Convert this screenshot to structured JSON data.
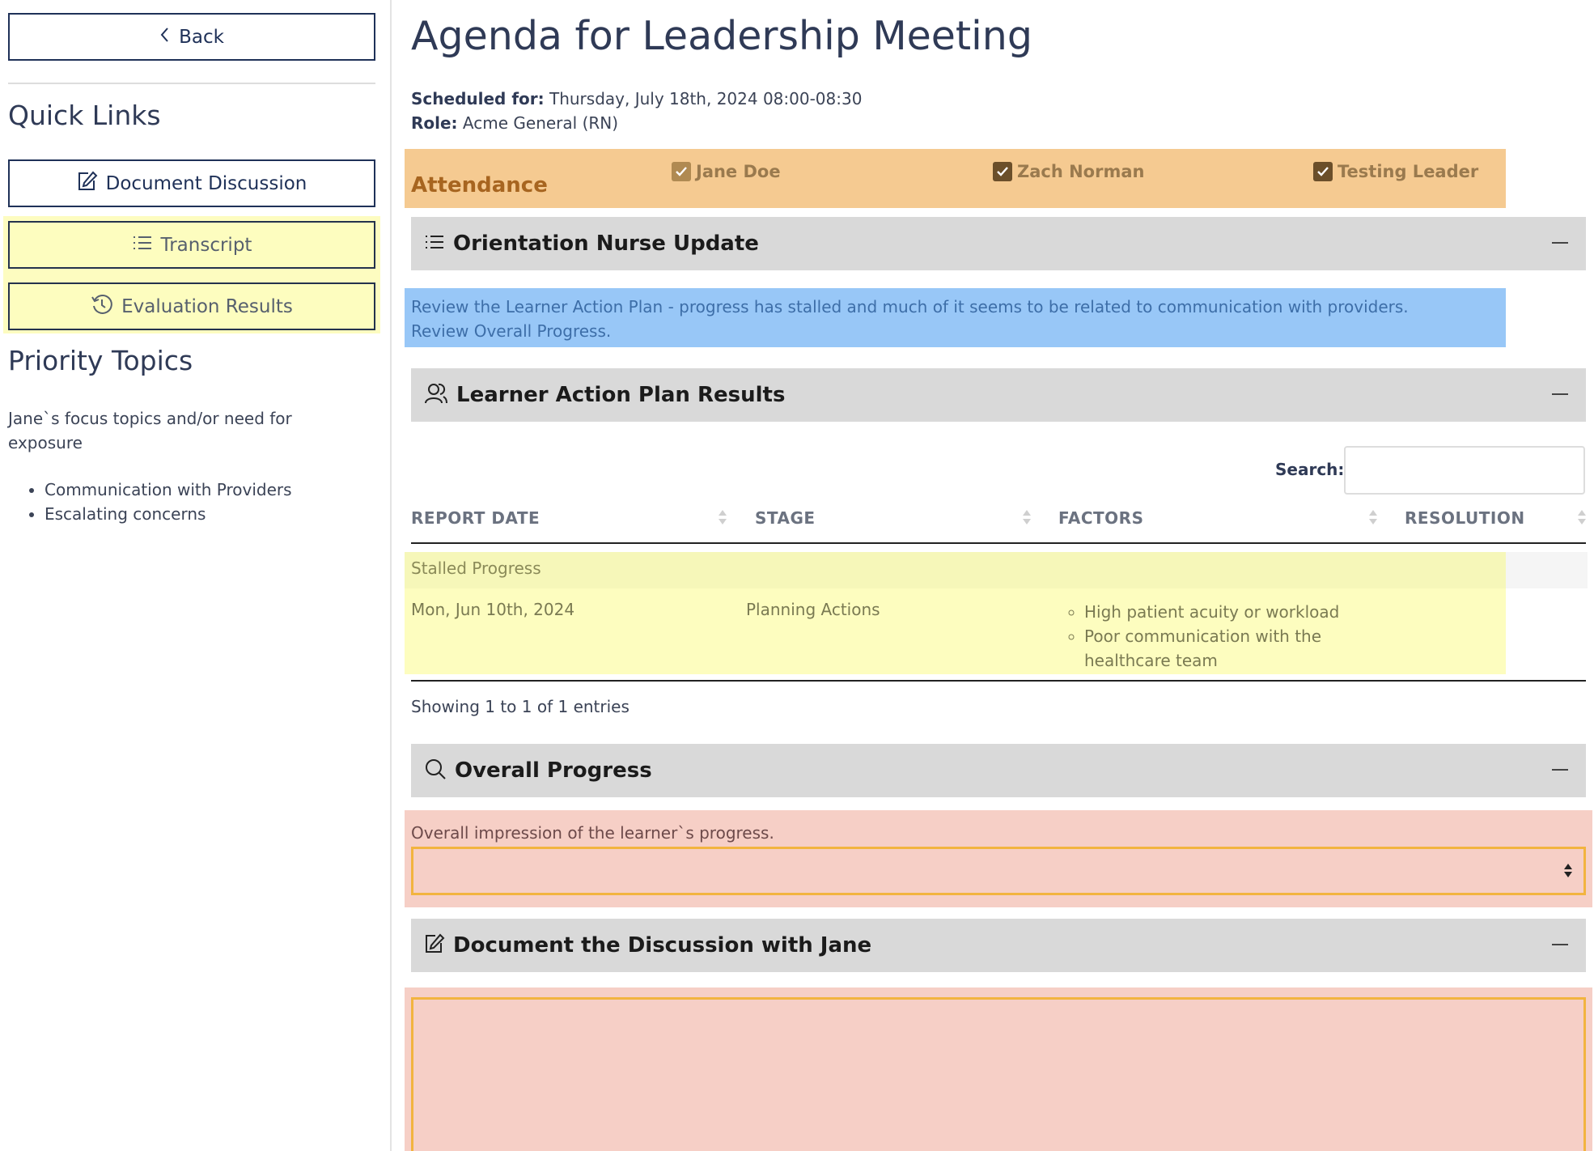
{
  "sidebar": {
    "back_label": "Back",
    "quick_links_heading": "Quick Links",
    "document_discussion_label": "Document Discussion",
    "transcript_label": "Transcript",
    "evaluation_results_label": "Evaluation Results",
    "priority_heading": "Priority Topics",
    "priority_description": "Jane`s focus topics and/or need for exposure",
    "priority_items": [
      "Communication with Providers",
      "Escalating concerns"
    ]
  },
  "main": {
    "title": "Agenda for Leadership Meeting",
    "scheduled_label": "Scheduled for:",
    "scheduled_value": " Thursday, July 18th, 2024 08:00-08:30",
    "role_label": "Role:",
    "role_value": " Acme General (RN)",
    "attendance": {
      "label": "Attendance",
      "attendees": [
        {
          "name": "Jane Doe",
          "checked": true
        },
        {
          "name": "Zach Norman",
          "checked": true
        },
        {
          "name": "Testing Leader",
          "checked": true
        }
      ]
    },
    "sections": {
      "orientation": {
        "title": "Orientation Nurse Update",
        "note_line1": "Review the Learner Action Plan - progress has stalled and much of it seems to be related to communication with providers.",
        "note_line2": "Review Overall Progress."
      },
      "learner_action_plan": {
        "title": "Learner Action Plan Results",
        "search_label": "Search:",
        "search_value": "",
        "columns": [
          "REPORT DATE",
          "STAGE",
          "FACTORS",
          "RESOLUTION"
        ],
        "group_label": "Stalled Progress",
        "rows": [
          {
            "report_date": "Mon, Jun 10th, 2024",
            "stage": "Planning Actions",
            "factors": [
              "High patient acuity or workload",
              "Poor communication with the healthcare team"
            ],
            "resolution": ""
          }
        ],
        "showing": "Showing 1 to 1 of 1 entries"
      },
      "overall_progress": {
        "title": "Overall Progress",
        "label": "Overall impression of the learner`s progress.",
        "selected_value": ""
      },
      "discussion": {
        "title": "Document the Discussion with Jane",
        "value": ""
      }
    }
  },
  "colors": {
    "attendance_bg": "#f5ca91",
    "note_bg": "#98c7f7",
    "highlight_yellow": "#fdfdbf",
    "required_bg": "#f6cfc6",
    "required_border": "#f2b43f",
    "section_bar_bg": "#d9d9d9"
  },
  "icons": {
    "back": "chevron-left-icon",
    "document_discussion": "edit-icon",
    "transcript": "list-icon",
    "evaluation_results": "history-icon",
    "orientation": "list-icon",
    "learner": "users-icon",
    "progress": "search-icon",
    "discussion": "edit-icon"
  }
}
